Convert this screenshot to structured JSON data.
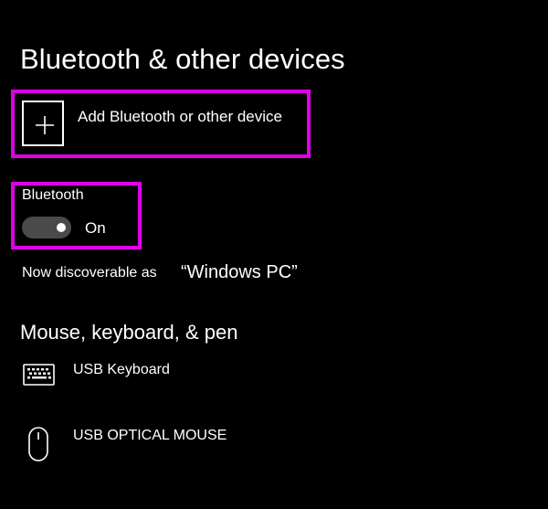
{
  "header": {
    "title": "Bluetooth & other devices"
  },
  "add_device": {
    "label": "Add Bluetooth or other device",
    "icon": "plus-icon"
  },
  "bluetooth": {
    "label": "Bluetooth",
    "state_label": "On",
    "enabled": true
  },
  "discoverable": {
    "prefix": "Now discoverable as",
    "device_name": "“Windows PC”"
  },
  "devices_section": {
    "title": "Mouse, keyboard, & pen",
    "items": [
      {
        "label": "USB Keyboard",
        "icon": "keyboard-icon"
      },
      {
        "label": "USB OPTICAL MOUSE",
        "icon": "mouse-icon"
      }
    ]
  },
  "colors": {
    "background": "#000000",
    "text": "#ffffff",
    "highlight": "#e000e8",
    "toggle_track": "#4a4a4a"
  }
}
